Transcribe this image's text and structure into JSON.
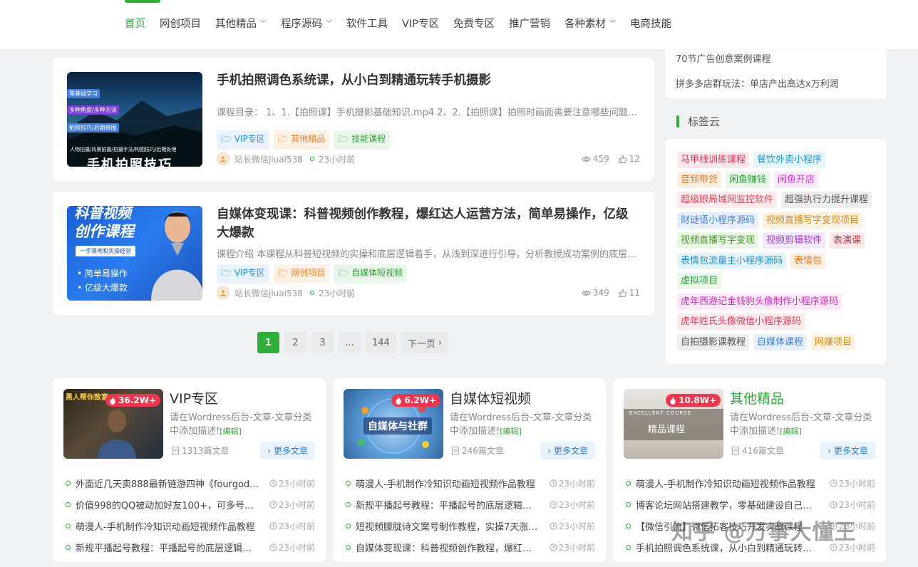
{
  "nav": {
    "items": [
      {
        "label": "首页",
        "active": true,
        "dropdown": false
      },
      {
        "label": "网创项目",
        "dropdown": false
      },
      {
        "label": "其他精品",
        "dropdown": true
      },
      {
        "label": "程序源码",
        "dropdown": true
      },
      {
        "label": "软件工具",
        "dropdown": false
      },
      {
        "label": "VIP专区",
        "dropdown": false
      },
      {
        "label": "免费专区",
        "dropdown": false
      },
      {
        "label": "推广营销",
        "dropdown": false
      },
      {
        "label": "各种素材",
        "dropdown": true
      },
      {
        "label": "电商技能",
        "dropdown": false
      }
    ]
  },
  "posts": [
    {
      "title": "手机拍照调色系统课，从小白到精通玩转手机摄影",
      "desc": "课程目录： 1、1.【拍照课】手机摄影基础知识.mp4 2、2.【拍照课】拍照时画面需要注意哪些问题.mp4",
      "tags": [
        {
          "label": "VIP专区",
          "color": "blue"
        },
        {
          "label": "其他精品",
          "color": "orange"
        },
        {
          "label": "技能课程",
          "color": "green"
        }
      ],
      "author": "站长微信jiuai538",
      "time": "23小时前",
      "views": "459",
      "likes": "12",
      "thumb": {
        "badges": [
          "零基础学习",
          "多种角度/多种方法",
          "拍照技巧/后期修图"
        ],
        "caption": "人物拍摄/风景拍摄/拍摄手法/构图技巧/后期处理",
        "big": "手机拍照技巧"
      }
    },
    {
      "title": "自媒体变现课：科普视频创作教程，爆红达人运营方法，简单易操作，亿级大爆款",
      "desc": "课程介绍 本课程从科普短视频的实操和底层逻辑着手，从浅到深进行引导，分析教授成功案例的底层逻辑",
      "tags": [
        {
          "label": "VIP专区",
          "color": "blue"
        },
        {
          "label": "网创项目",
          "color": "orange"
        },
        {
          "label": "自媒体短视频",
          "color": "green"
        }
      ],
      "author": "站长微信jiuai538",
      "time": "23小时前",
      "views": "349",
      "likes": "11",
      "thumb": {
        "top": "科普视频",
        "big": "创作课程",
        "sub": "一手落地和实操经验",
        "bullets": [
          "• 简单易操作",
          "• 亿级大爆款"
        ]
      }
    }
  ],
  "pagination": {
    "pages": [
      "1",
      "2",
      "3",
      "...",
      "144"
    ],
    "next": "下一页"
  },
  "sidebar": {
    "links": [
      "70节广告创意案例课程",
      "拼多多店群玩法：单店产出高达x万利润"
    ],
    "tagcloud_title": "标签云",
    "tags": [
      {
        "label": "马甲线训练课程",
        "bg": "#fde8ec",
        "fg": "#e2355a"
      },
      {
        "label": "餐饮外卖小程序",
        "bg": "#e6f4fb",
        "fg": "#1f9bd1"
      },
      {
        "label": "音频带货",
        "bg": "#fdf0e3",
        "fg": "#ea7b1f"
      },
      {
        "label": "闲鱼赚钱",
        "bg": "#e9f8eb",
        "fg": "#2ea137"
      },
      {
        "label": "闲鱼开店",
        "bg": "#fbeafb",
        "fg": "#d13ad1"
      },
      {
        "label": "超级眼局域网监控软件",
        "bg": "#fdebed",
        "fg": "#e24b5e"
      },
      {
        "label": "超强执行力提升课程",
        "bg": "#eeeeee",
        "fg": "#555555"
      },
      {
        "label": "财谜语小程序源码",
        "bg": "#e8f0fd",
        "fg": "#3f7ee0"
      },
      {
        "label": "视频直播写字变现项目",
        "bg": "#fdf3e0",
        "fg": "#d98a10"
      },
      {
        "label": "视频直播写字变现",
        "bg": "#eaf6e4",
        "fg": "#4b9e2a"
      },
      {
        "label": "视频剪辑软件",
        "bg": "#f3e8fb",
        "fg": "#9b3fd4"
      },
      {
        "label": "表演课",
        "bg": "#fde8ea",
        "fg": "#d92b3a"
      },
      {
        "label": "表情包流量主小程序源码",
        "bg": "#e6f3fb",
        "fg": "#2090d0"
      },
      {
        "label": "表情包",
        "bg": "#fdf0e3",
        "fg": "#ea7b1f"
      },
      {
        "label": "虚拟项目",
        "bg": "#e9f8eb",
        "fg": "#2ea137"
      },
      {
        "label": "虎年西游记金钱豹头像制作小程序源码",
        "bg": "#fbe8f8",
        "fg": "#d02fb4"
      },
      {
        "label": "虎年姓氏头像微信小程序源码",
        "bg": "#fdeaed",
        "fg": "#e23c55"
      },
      {
        "label": "自拍摄影课教程",
        "bg": "#eeeeee",
        "fg": "#555555"
      },
      {
        "label": "自媒体课程",
        "bg": "#e8f0fd",
        "fg": "#3f7ee0"
      },
      {
        "label": "网赚项目",
        "bg": "#fdf3e0",
        "fg": "#d98a10"
      }
    ]
  },
  "categories": [
    {
      "title": "VIP专区",
      "hot": "36.2W+",
      "desc": "请在Wordress后台-文章-文章分类中添加描述!",
      "edit": "[编辑]",
      "count": "1313篇文章",
      "more": "更多文章",
      "thumb_text": "黑人帮你致富",
      "items": [
        {
          "title": "外面近几天卖888最新链游四神《fourgods》游戏打金项目",
          "time": "23小时前"
        },
        {
          "title": "价值998的QQ被动加好友100+，可多号同时操作，日引流量无上限",
          "time": "23小时前"
        },
        {
          "title": "萌漫人-手机制作冷知识动画短视频作品教程",
          "time": "23小时前"
        },
        {
          "title": "新规平播起号教程：平播起号的底层逻辑和玩法",
          "time": "23小时前"
        }
      ]
    },
    {
      "title": "自媒体短视频",
      "hot": "6.2W+",
      "desc": "请在Wordress后台-文章-文章分类中添加描述!",
      "edit": "[编辑]",
      "count": "246篇文章",
      "more": "更多文章",
      "thumb_text": "自媒体与社群",
      "items": [
        {
          "title": "萌漫人-手机制作冷知识动画短视频作品教程",
          "time": "23小时前"
        },
        {
          "title": "新规平播起号教程：平播起号的底层逻辑和玩法",
          "time": "23小时前"
        },
        {
          "title": "短视频朦胧诗文案号制作教程，实操7天涨粉过万",
          "time": "23小时前"
        },
        {
          "title": "自媒体变现课：科普视频创作教程，爆红达人运营方法",
          "time": "23小时前"
        }
      ]
    },
    {
      "title": "其他精品",
      "hot": "10.8W+",
      "desc": "请在Wordress后台-文章-文章分类中添加描述!",
      "edit": "[编辑]",
      "count": "416篇文章",
      "more": "更多文章",
      "thumb_text": "精品课程",
      "thumb_sub": "EXCELLENT COURSE",
      "items": [
        {
          "title": "萌漫人-手机制作冷知识动画短视频作品教程",
          "time": "23小时前"
        },
        {
          "title": "博客论坛网站搭建教学，零基础建设自己的网站",
          "time": "23小时前"
        },
        {
          "title": "【微信引流】微信拓客技巧开发实战课程",
          "time": "23小时前"
        },
        {
          "title": "手机拍照调色系统课，从小白到精通玩转手机摄影",
          "time": "23小时前"
        }
      ]
    }
  ],
  "watermark": "知乎 @万事大懂王"
}
